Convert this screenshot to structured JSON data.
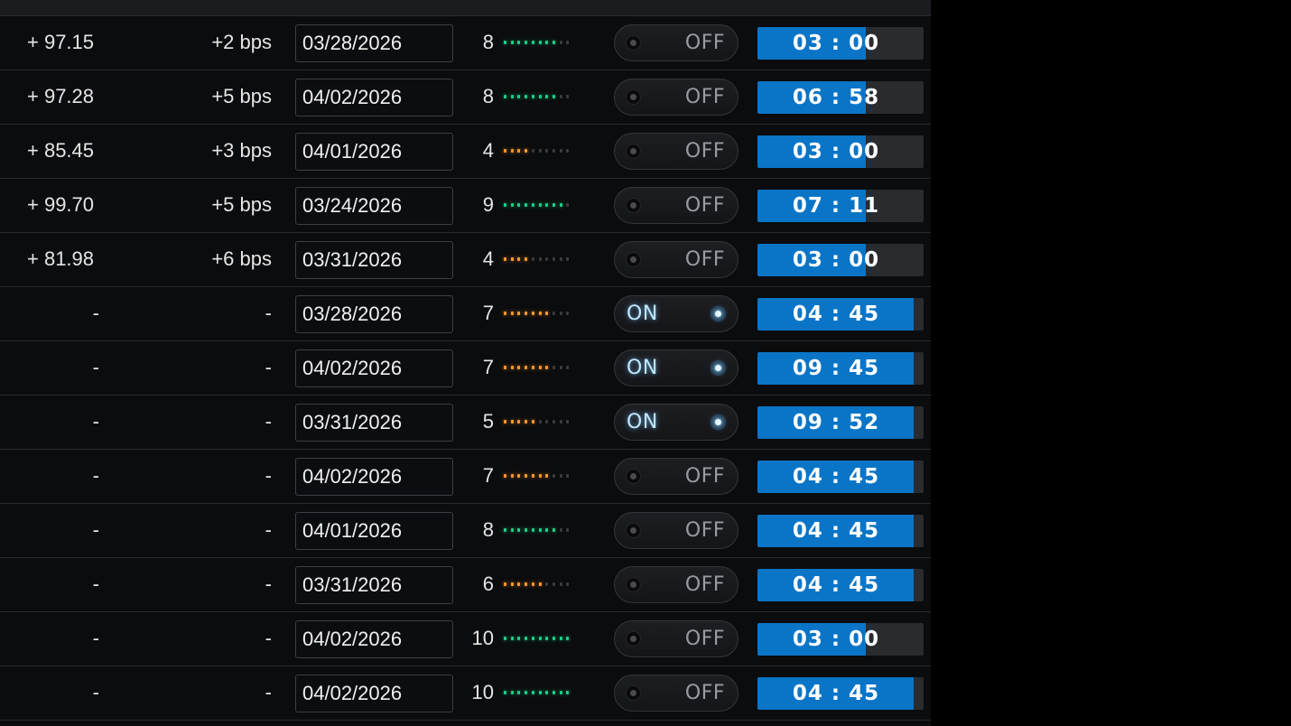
{
  "colors": {
    "background": "#0b0c0e",
    "score_high": "#19d28a",
    "score_mid": "#ff9a2e",
    "timer_fill": "#0a75c7",
    "toggle_on_glow": "#bfe6ff"
  },
  "rows": [
    {
      "price": "+ 97.15",
      "spread": "+2 bps",
      "date": "03/28/2026",
      "score": "8",
      "score_value": 8,
      "score_level": "high",
      "toggle": "OFF",
      "timer": "03 : 00",
      "timer_progress": 0.65
    },
    {
      "price": "+ 97.28",
      "spread": "+5 bps",
      "date": "04/02/2026",
      "score": "8",
      "score_value": 8,
      "score_level": "high",
      "toggle": "OFF",
      "timer": "06 : 58",
      "timer_progress": 0.65
    },
    {
      "price": "+ 85.45",
      "spread": "+3 bps",
      "date": "04/01/2026",
      "score": "4",
      "score_value": 4,
      "score_level": "mid",
      "toggle": "OFF",
      "timer": "03 : 00",
      "timer_progress": 0.65
    },
    {
      "price": "+ 99.70",
      "spread": "+5 bps",
      "date": "03/24/2026",
      "score": "9",
      "score_value": 9,
      "score_level": "high",
      "toggle": "OFF",
      "timer": "07 : 11",
      "timer_progress": 0.65
    },
    {
      "price": "+ 81.98",
      "spread": "+6 bps",
      "date": "03/31/2026",
      "score": "4",
      "score_value": 4,
      "score_level": "mid",
      "toggle": "OFF",
      "timer": "03 : 00",
      "timer_progress": 0.65
    },
    {
      "price": "-",
      "spread": "-",
      "date": "03/28/2026",
      "score": "7",
      "score_value": 7,
      "score_level": "mid",
      "toggle": "ON",
      "timer": "04 : 45",
      "timer_progress": 0.94
    },
    {
      "price": "-",
      "spread": "-",
      "date": "04/02/2026",
      "score": "7",
      "score_value": 7,
      "score_level": "mid",
      "toggle": "ON",
      "timer": "09 : 45",
      "timer_progress": 0.94
    },
    {
      "price": "-",
      "spread": "-",
      "date": "03/31/2026",
      "score": "5",
      "score_value": 5,
      "score_level": "mid",
      "toggle": "ON",
      "timer": "09 : 52",
      "timer_progress": 0.94
    },
    {
      "price": "-",
      "spread": "-",
      "date": "04/02/2026",
      "score": "7",
      "score_value": 7,
      "score_level": "mid",
      "toggle": "OFF",
      "timer": "04 : 45",
      "timer_progress": 0.94
    },
    {
      "price": "-",
      "spread": "-",
      "date": "04/01/2026",
      "score": "8",
      "score_value": 8,
      "score_level": "high",
      "toggle": "OFF",
      "timer": "04 : 45",
      "timer_progress": 0.94
    },
    {
      "price": "-",
      "spread": "-",
      "date": "03/31/2026",
      "score": "6",
      "score_value": 6,
      "score_level": "mid",
      "toggle": "OFF",
      "timer": "04 : 45",
      "timer_progress": 0.94
    },
    {
      "price": "-",
      "spread": "-",
      "date": "04/02/2026",
      "score": "10",
      "score_value": 10,
      "score_level": "high",
      "toggle": "OFF",
      "timer": "03 : 00",
      "timer_progress": 0.65
    },
    {
      "price": "-",
      "spread": "-",
      "date": "04/02/2026",
      "score": "10",
      "score_value": 10,
      "score_level": "high",
      "toggle": "OFF",
      "timer": "04 : 45",
      "timer_progress": 0.94
    }
  ]
}
